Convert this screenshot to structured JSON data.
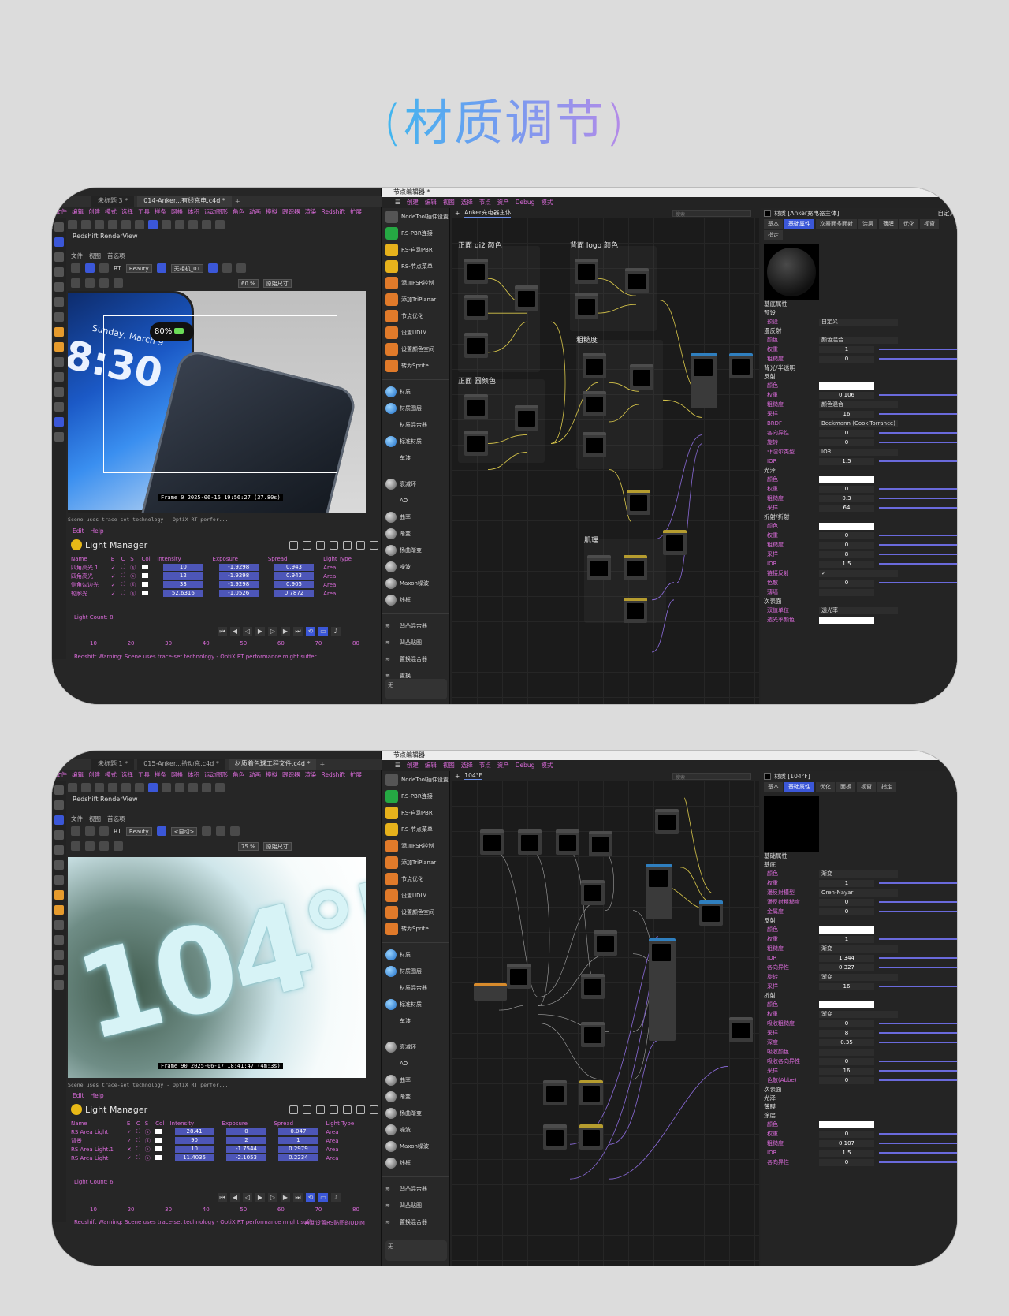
{
  "title": "(材质调节)",
  "shot1": {
    "c4d": {
      "tabs": [
        "ma 4D 2024.2.0 - [014-Anker充电宝--30W有线充电.c4d *] - 主要",
        "未标题 3 *",
        "014-Anker...有线充电.c4d *",
        "+"
      ],
      "menu": [
        "文件",
        "编辑",
        "创建",
        "模式",
        "选择",
        "工具",
        "样条",
        "网格",
        "体积",
        "运动图形",
        "角色",
        "动画",
        "模拟",
        "跟踪器",
        "渲染",
        "Redshift",
        "扩展"
      ],
      "renderview_title": "Redshift RenderView",
      "rv_menu": [
        "文件",
        "视图",
        "首选项"
      ],
      "rv_beauty": "Beauty",
      "rv_camera": "无相机_01",
      "rv_zoom": "60 %",
      "rv_size": "原始尺寸",
      "phone_time": "8:30",
      "phone_date": "Sunday, March 9",
      "battery": "80%",
      "frame_label": "Frame  0   2025-06-16  19:56:27  (37.80s)",
      "warn_line": "Scene uses trace-set technology - OptiX RT perfor...",
      "lm_menu": [
        "Edit",
        "Help"
      ],
      "lm_title": "Light Manager",
      "lm_headers": [
        "Name",
        "E",
        "C",
        "S",
        "Col",
        "Intensity",
        "Exposure",
        "Spread",
        "Light Type"
      ],
      "lights": [
        {
          "name": "四角高光 1",
          "intensity": "10",
          "exposure": "-1.9298",
          "spread": "0.943",
          "type": "Area",
          "ok": true
        },
        {
          "name": "四角高光",
          "intensity": "12",
          "exposure": "-1.9298",
          "spread": "0.943",
          "type": "Area",
          "ok": true
        },
        {
          "name": "侧角勾边光",
          "intensity": "33",
          "exposure": "-1.9298",
          "spread": "0.905",
          "type": "Area",
          "ok": true
        },
        {
          "name": "轮廓光",
          "intensity": "52.6316",
          "exposure": "-1.0526",
          "spread": "0.7872",
          "type": "Area",
          "ok": true
        }
      ],
      "light_count": "Light Count: 8",
      "ruler": [
        "10",
        "20",
        "30",
        "40",
        "50",
        "60",
        "70",
        "80"
      ],
      "bottom_warning": "Redshift Warning: Scene uses trace-set technology - OptiX RT performance might suffer"
    },
    "ne": {
      "title": "节点编辑器 *",
      "menu": [
        "创建",
        "编辑",
        "视图",
        "选择",
        "节点",
        "资产",
        "Debug",
        "模式"
      ],
      "tab": "Anker充电器主体",
      "search_placeholder": "搜索",
      "lib": [
        "NodeTool插件设置",
        "RS-PBR连接",
        "RS-自动PBR",
        "RS-节点菜单",
        "添加PSR控制",
        "添加TriPlanar",
        "节点优化",
        "设置UDIM",
        "设置颜色空间",
        "转为Sprite"
      ],
      "lib_mats": [
        "材质",
        "材质图层",
        "材质混合器",
        "标准材质",
        "车漆"
      ],
      "lib_tex": [
        "衰减环",
        "AO",
        "曲率",
        "渐变",
        "杨曲渐变",
        "噪波",
        "Maxon噪波",
        "线框"
      ],
      "lib_bump": [
        "凹凸混合器",
        "凹凸贴图",
        "置换混合器",
        "置换"
      ],
      "bottom_box": "无",
      "groups": [
        "正面 qi2 颜色",
        "背面 logo 颜色",
        "粗糙度",
        "正面 圆颜色",
        "肌理"
      ],
      "attr": {
        "head": "材质 [Anker充电器主体]",
        "mode": "自定义",
        "tabs": [
          "基本",
          "基础属性",
          "次表面多面射",
          "涂层",
          "薄膜",
          "优化",
          "视窗",
          "指定"
        ],
        "sections": [
          {
            "title": "基底属性",
            "rows": []
          },
          {
            "title": "预设",
            "rows": [
              {
                "k": "预设",
                "v": "自定义"
              }
            ]
          },
          {
            "title": "漫反射",
            "rows": [
              {
                "k": "颜色",
                "v": "颜色混合"
              },
              {
                "k": "权重",
                "v": "1"
              },
              {
                "k": "粗糙度",
                "v": "0"
              }
            ]
          },
          {
            "title": "背光/半透明",
            "rows": []
          },
          {
            "title": "反射",
            "rows": [
              {
                "k": "颜色",
                "v": ""
              },
              {
                "k": "权重",
                "v": "0.106"
              },
              {
                "k": "粗糙度",
                "v": "颜色混合"
              },
              {
                "k": "采样",
                "v": "16"
              },
              {
                "k": "BRDF",
                "v": "Beckmann (Cook-Torrance)"
              },
              {
                "k": "各向异性",
                "v": "0"
              },
              {
                "k": "旋转",
                "v": "0"
              },
              {
                "k": "菲涅尔类型",
                "v": "IOR"
              },
              {
                "k": "IOR",
                "v": "1.5"
              }
            ]
          },
          {
            "title": "光泽",
            "rows": [
              {
                "k": "颜色",
                "v": ""
              },
              {
                "k": "权重",
                "v": "0"
              },
              {
                "k": "粗糙度",
                "v": "0.3"
              },
              {
                "k": "采样",
                "v": "64"
              }
            ]
          },
          {
            "title": "折射/折射",
            "rows": [
              {
                "k": "颜色",
                "v": ""
              },
              {
                "k": "权重",
                "v": "0"
              },
              {
                "k": "粗糙度",
                "v": "0"
              },
              {
                "k": "采样",
                "v": "8"
              },
              {
                "k": "IOR",
                "v": "1.5"
              },
              {
                "k": "链接反射",
                "v": "✓"
              },
              {
                "k": "色散",
                "v": "0"
              },
              {
                "k": "薄墙",
                "v": ""
              }
            ]
          },
          {
            "title": "次表面",
            "rows": [
              {
                "k": "双值单位",
                "v": "透光率"
              },
              {
                "k": "透光率颜色",
                "v": ""
              }
            ]
          }
        ]
      }
    }
  },
  "shot2": {
    "c4d": {
      "tabs": [
        "ma 4D 2024.2.0 - [材质着色球工程文件.c4d *] - Main",
        "未标题 1 *",
        "015-Anker...拾动充.c4d *",
        "材质着色球工程文件.c4d *",
        "+"
      ],
      "menu": [
        "文件",
        "编辑",
        "创建",
        "模式",
        "选择",
        "工具",
        "样条",
        "网格",
        "体积",
        "运动图形",
        "角色",
        "动画",
        "模拟",
        "跟踪器",
        "渲染",
        "Redshift",
        "扩展"
      ],
      "renderview_title": "Redshift RenderView",
      "rv_menu": [
        "文件",
        "视图",
        "首选项"
      ],
      "rv_beauty": "Beauty",
      "rv_camera": "<自动>",
      "rv_zoom": "75 %",
      "rv_size": "原始尺寸",
      "render_text": "104°F",
      "frame_label": "Frame  90   2025-06-17  18:41:47  (4m:3s)",
      "warn_line": "Scene uses trace-set technology - OptiX RT perfor...",
      "lm_menu": [
        "Edit",
        "Help"
      ],
      "lm_title": "Light Manager",
      "lm_headers": [
        "Name",
        "E",
        "C",
        "S",
        "Col",
        "Intensity",
        "Exposure",
        "Spread",
        "Light Type"
      ],
      "lights": [
        {
          "name": "RS Area Light",
          "intensity": "28.41",
          "exposure": "0",
          "spread": "0.047",
          "type": "Area",
          "ok": true
        },
        {
          "name": "背景",
          "intensity": "90",
          "exposure": "2",
          "spread": "1",
          "type": "Area",
          "ok": true
        },
        {
          "name": "RS Area Light.1",
          "intensity": "10",
          "exposure": "-1.7544",
          "spread": "0.2979",
          "type": "Area",
          "ok": false
        },
        {
          "name": "RS Area Light",
          "intensity": "11.4035",
          "exposure": "-2.1053",
          "spread": "0.2234",
          "type": "Area",
          "ok": true
        }
      ],
      "light_count": "Light Count: 6",
      "ruler": [
        "10",
        "20",
        "30",
        "40",
        "50",
        "60",
        "70",
        "80"
      ],
      "bottom_warning": "Redshift Warning: Scene uses trace-set technology - OptiX RT performance might suffer",
      "bottom_right": "自动设置RS贴图的UDIM"
    },
    "ne": {
      "title": "节点编辑器",
      "menu": [
        "创建",
        "编辑",
        "视图",
        "选择",
        "节点",
        "资产",
        "Debug",
        "模式"
      ],
      "tab": "104°F",
      "search_placeholder": "搜索",
      "lib": [
        "NodeTool插件设置",
        "RS-PBR连接",
        "RS-自动PBR",
        "RS-节点菜单",
        "添加PSR控制",
        "添加TriPlanar",
        "节点优化",
        "设置UDIM",
        "设置颜色空间",
        "转为Sprite"
      ],
      "lib_mats": [
        "材质",
        "材质图层",
        "材质混合器",
        "标准材质",
        "车漆"
      ],
      "lib_tex": [
        "衰减环",
        "AO",
        "曲率",
        "渐变",
        "杨曲渐变",
        "噪波",
        "Maxon噪波",
        "线框"
      ],
      "lib_bump": [
        "凹凸混合器",
        "凹凸贴图",
        "置换混合器"
      ],
      "bottom_box": "无",
      "attr": {
        "head": "材质 [104°F]",
        "tabs": [
          "基本",
          "基础属性",
          "优化",
          "面板",
          "视窗",
          "指定"
        ],
        "sections": [
          {
            "title": "基础属性",
            "rows": []
          },
          {
            "title": "基底",
            "rows": [
              {
                "k": "颜色",
                "v": "渐变"
              },
              {
                "k": "权重",
                "v": "1"
              },
              {
                "k": "漫反射模型",
                "v": "Oren-Nayar"
              },
              {
                "k": "漫反射粗糙度",
                "v": "0"
              },
              {
                "k": "金属度",
                "v": "0"
              }
            ]
          },
          {
            "title": "反射",
            "rows": [
              {
                "k": "颜色",
                "v": ""
              },
              {
                "k": "权重",
                "v": "1"
              },
              {
                "k": "粗糙度",
                "v": "渐变"
              },
              {
                "k": "IOR",
                "v": "1.344"
              },
              {
                "k": "各向异性",
                "v": "0.327"
              },
              {
                "k": "旋转",
                "v": "渐变"
              },
              {
                "k": "采样",
                "v": "16"
              }
            ]
          },
          {
            "title": "折射",
            "rows": [
              {
                "k": "颜色",
                "v": ""
              },
              {
                "k": "权重",
                "v": "渐变"
              },
              {
                "k": "吸收粗糙度",
                "v": "0"
              },
              {
                "k": "采样",
                "v": "8"
              },
              {
                "k": "深度",
                "v": "0.35"
              },
              {
                "k": "吸收颜色",
                "v": ""
              },
              {
                "k": "吸收各向异性",
                "v": "0"
              },
              {
                "k": "采样",
                "v": "16"
              },
              {
                "k": "色散(Abbe)",
                "v": "0"
              }
            ]
          },
          {
            "title": "次表面",
            "rows": []
          },
          {
            "title": "光泽",
            "rows": []
          },
          {
            "title": "薄膜",
            "rows": []
          },
          {
            "title": "涂层",
            "rows": [
              {
                "k": "颜色",
                "v": ""
              },
              {
                "k": "权重",
                "v": "0"
              },
              {
                "k": "粗糙度",
                "v": "0.107"
              },
              {
                "k": "IOR",
                "v": "1.5"
              },
              {
                "k": "各向异性",
                "v": "0"
              }
            ]
          }
        ]
      }
    }
  }
}
